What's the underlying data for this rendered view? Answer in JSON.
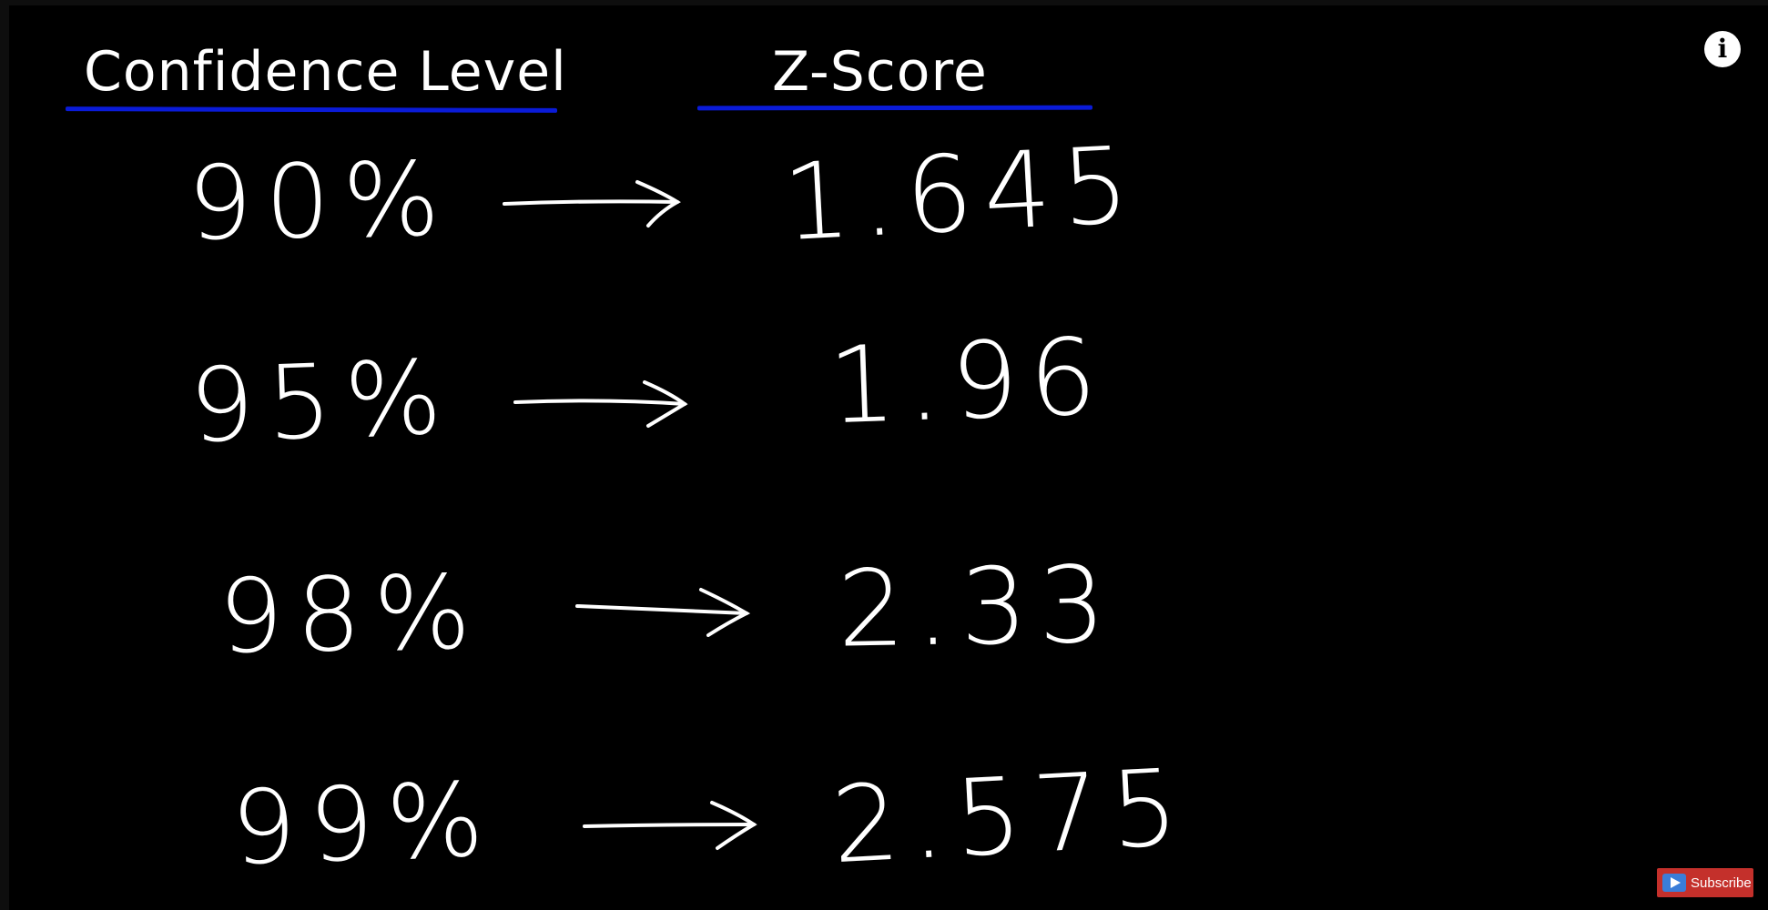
{
  "table": {
    "header_confidence": "Confidence Level",
    "header_zscore": "Z-Score",
    "underline_color": "#0a1bd8",
    "rows": [
      {
        "confidence": "90%",
        "zscore": "1.645"
      },
      {
        "confidence": "95%",
        "zscore": "1.96"
      },
      {
        "confidence": "98%",
        "zscore": "2.33"
      },
      {
        "confidence": "99%",
        "zscore": "2.575"
      }
    ]
  },
  "overlay": {
    "info_icon": "i",
    "subscribe_label": "Subscribe",
    "subscribe_color": "#c4302b"
  }
}
